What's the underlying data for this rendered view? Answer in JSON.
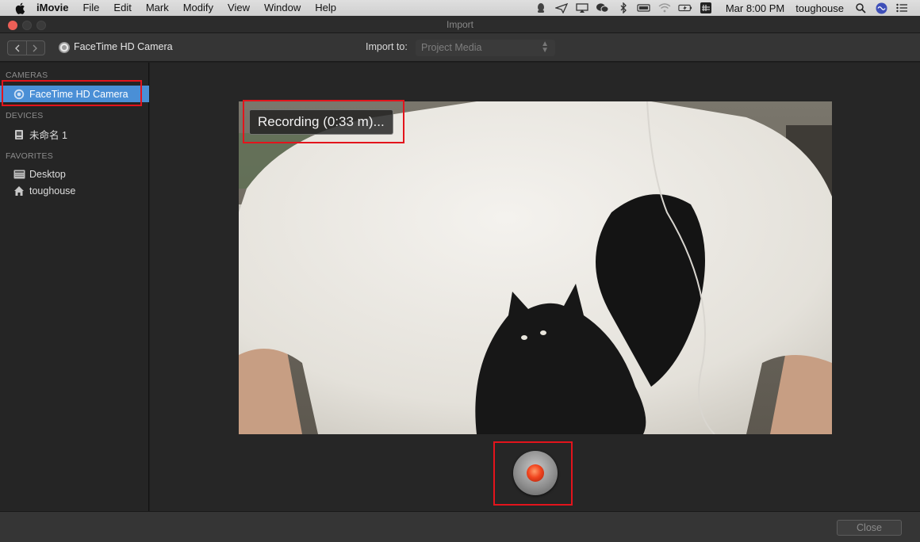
{
  "menubar": {
    "app_name": "iMovie",
    "items": [
      "File",
      "Edit",
      "Mark",
      "Modify",
      "View",
      "Window",
      "Help"
    ],
    "status_icons": [
      "qq-icon",
      "send-icon",
      "airplay-icon",
      "wechat-icon",
      "bluetooth-icon",
      "battery-icon",
      "wifi-icon",
      "charging-icon",
      "input-method-icon"
    ],
    "clock": "Mar 8:00 PM",
    "user": "toughouse"
  },
  "window": {
    "title": "Import"
  },
  "toolbar": {
    "camera_label": "FaceTime HD Camera",
    "import_to_label": "Import to:",
    "import_to_value": "Project Media"
  },
  "sidebar": {
    "cameras_header": "CAMERAS",
    "camera_item": "FaceTime HD Camera",
    "devices_header": "DEVICES",
    "device_item": "未命名 1",
    "favorites_header": "FAVORITES",
    "favorites": [
      "Desktop",
      "toughouse"
    ]
  },
  "preview": {
    "recording_status": "Recording (0:33 m)..."
  },
  "footer": {
    "close_label": "Close"
  },
  "colors": {
    "selection": "#4a8fd6",
    "record_red": "#f1451f",
    "annotation_red": "#e3141c"
  }
}
